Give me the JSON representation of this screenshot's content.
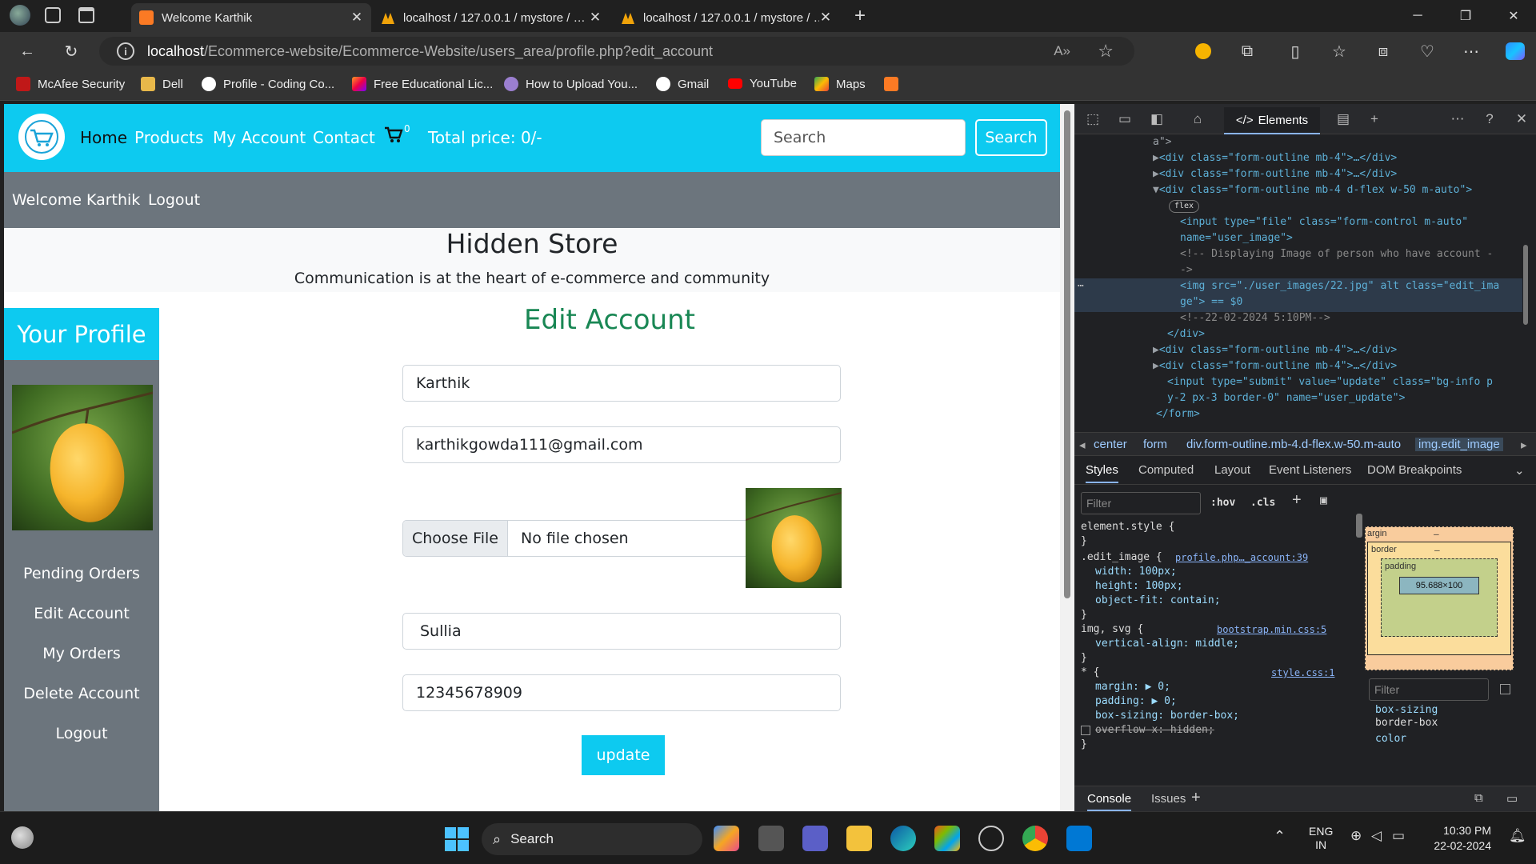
{
  "browser": {
    "tabs": [
      {
        "title": "Welcome Karthik",
        "active": true
      },
      {
        "title": "localhost / 127.0.0.1 / mystore / …",
        "active": false
      },
      {
        "title": "localhost / 127.0.0.1 / mystore / …",
        "active": false
      }
    ],
    "url_host": "localhost",
    "url_path": "/Ecommerce-website/Ecommerce-Website/users_area/profile.php?edit_account",
    "bookmarks": [
      "McAfee Security",
      "Dell",
      "Profile - Coding Co...",
      "Free Educational Lic...",
      "How to Upload You...",
      "Gmail",
      "YouTube",
      "Maps"
    ]
  },
  "site": {
    "nav": {
      "home": "Home",
      "products": "Products",
      "account": "My Account",
      "contact": "Contact",
      "cart_count": "0",
      "total": "Total price: 0/-"
    },
    "search": {
      "placeholder": "Search",
      "button": "Search"
    },
    "subnav": {
      "welcome": "Welcome Karthik",
      "logout": "Logout"
    },
    "store_name": "Hidden Store",
    "tagline": "Communication is at the heart of e-commerce and community",
    "sidebar": {
      "title": "Your Profile",
      "items": [
        "Pending Orders",
        "Edit Account",
        "My Orders",
        "Delete Account",
        "Logout"
      ]
    },
    "form": {
      "title": "Edit Account",
      "username": "Karthik",
      "email": "karthikgowda111@gmail.com",
      "file_button": "Choose File",
      "file_status": "No file chosen",
      "address": "Sullia",
      "mobile": "12345678909",
      "submit": "update"
    }
  },
  "devtools": {
    "tabs": {
      "elements": "Elements"
    },
    "dom_lines": [
      "a\">",
      "<div class=\"form-outline mb-4\">…</div>",
      "<div class=\"form-outline mb-4\">…</div>",
      "<div class=\"form-outline mb-4 d-flex  w-50 m-auto\">",
      "flex",
      "<input type=\"file\" class=\"form-control  m-auto\"",
      "name=\"user_image\">",
      "<!-- Displaying Image of person who  have account -",
      "->",
      "<img src=\"./user_images/22.jpg\" alt class=\"edit_ima",
      "ge\"> == $0",
      "<!--22-02-2024 5:10PM-->",
      "</div>",
      "<div class=\"form-outline mb-4\">…</div>",
      "<div class=\"form-outline mb-4\">…</div>",
      "<input type=\"submit\" value=\"update\" class=\"bg-info p",
      "y-2 px-3 border-0\" name=\"user_update\">",
      "</form>"
    ],
    "breadcrumbs": [
      "center",
      "form",
      "div.form-outline.mb-4.d-flex.w-50.m-auto",
      "img.edit_image"
    ],
    "style_tabs": [
      "Styles",
      "Computed",
      "Layout",
      "Event Listeners",
      "DOM Breakpoints"
    ],
    "filter_placeholder": "Filter",
    "hov": ":hov",
    "cls": ".cls",
    "rules": [
      "element.style {",
      "}",
      ".edit_image {",
      "profile.php…_account:39",
      "width: 100px;",
      "height: 100px;",
      "object-fit: contain;",
      "}",
      "img, svg {",
      "bootstrap.min.css:5",
      "vertical-align: middle;",
      "}",
      "* {",
      "style.css:1",
      "margin: ▶ 0;",
      "padding: ▶ 0;",
      "box-sizing: border-box;",
      "overflow-x: hidden;",
      "}"
    ],
    "boxmodel": {
      "margin": "argin",
      "border": "border",
      "padding": "padding",
      "content": "95.688×100",
      "dash": "–"
    },
    "computed": {
      "filter": "Filter",
      "prop": "box-sizing",
      "val": "border-box",
      "next": "color"
    },
    "console_tabs": [
      "Console",
      "Issues"
    ]
  },
  "taskbar": {
    "search": "Search",
    "lang1": "ENG",
    "lang2": "IN",
    "time": "10:30 PM",
    "date": "22-02-2024"
  }
}
